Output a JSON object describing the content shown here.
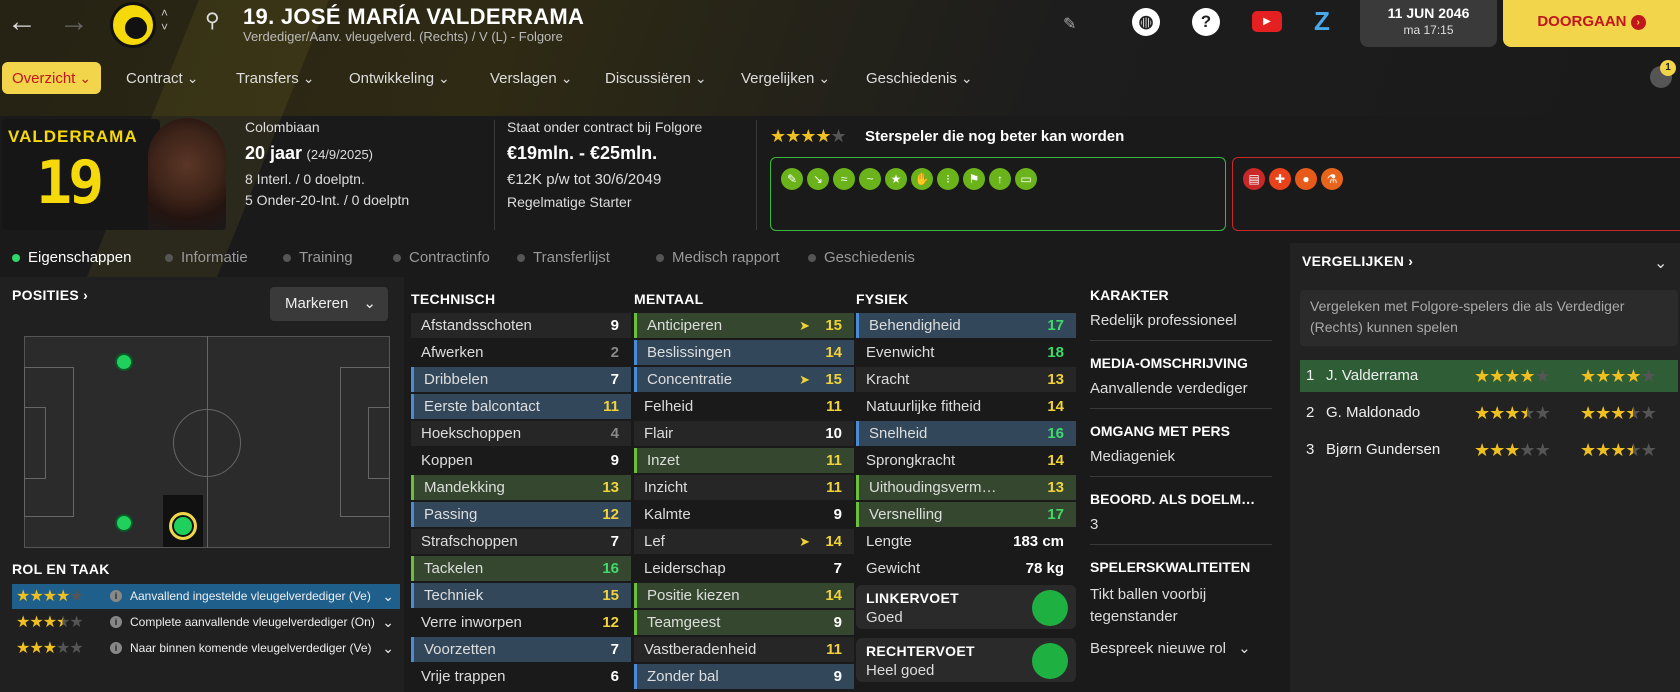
{
  "header": {
    "player_name": "19. JOSÉ MARÍA VALDERRAMA",
    "subtitle": "Verdediger/Aanv. vleugelverd. (Rechts) / V (L) - Folgore",
    "date": "11 JUN 2046",
    "time": "ma 17:15",
    "continue_label": "DOORGAAN",
    "notification_count": "1"
  },
  "menu": [
    {
      "label": "Overzicht",
      "active": true
    },
    {
      "label": "Contract"
    },
    {
      "label": "Transfers"
    },
    {
      "label": "Ontwikkeling"
    },
    {
      "label": "Verslagen"
    },
    {
      "label": "Discussiëren"
    },
    {
      "label": "Vergelijken"
    },
    {
      "label": "Geschiedenis"
    }
  ],
  "card": {
    "shirt_name": "VALDERRAMA",
    "shirt_number": "19",
    "nationality": "Colombiaan",
    "age": "20 jaar",
    "dob": "(24/9/2025)",
    "caps": "8 Interl. / 0 doelptn.",
    "youth_caps": "5 Onder-20-Int. / 0 doelptn",
    "contract_line": "Staat onder contract bij Folgore",
    "value": "€19mln. - €25mln.",
    "wage": "€12K p/w tot 30/6/2049",
    "status": "Regelmatige Starter",
    "rating_text": "Sterspeler die nog beter kan worden",
    "rating_stars": 4
  },
  "subtabs": [
    "Eigenschappen",
    "Informatie",
    "Training",
    "Contractinfo",
    "Transferlijst",
    "Medisch rapport",
    "Geschiedenis"
  ],
  "positions": {
    "title": "POSITIES",
    "mark_label": "Markeren"
  },
  "roles": {
    "title": "ROL EN TAAK",
    "items": [
      {
        "name": "Aanvallend ingestelde vleugelverdediger (Ve)",
        "stars": 4
      },
      {
        "name": "Complete aanvallende vleugelverdediger (On)",
        "stars": 3.5
      },
      {
        "name": "Naar binnen komende vleugelverdediger (Ve)",
        "stars": 3
      }
    ]
  },
  "technical": {
    "title": "TECHNISCH",
    "rows": [
      {
        "name": "Afstandsschoten",
        "value": "9",
        "hl": "",
        "vc": "white"
      },
      {
        "name": "Afwerken",
        "value": "2",
        "hl": "",
        "vc": "grey"
      },
      {
        "name": "Dribbelen",
        "value": "7",
        "hl": "blue",
        "vc": "white"
      },
      {
        "name": "Eerste balcontact",
        "value": "11",
        "hl": "blue",
        "vc": "yellow"
      },
      {
        "name": "Hoekschoppen",
        "value": "4",
        "hl": "",
        "vc": "grey"
      },
      {
        "name": "Koppen",
        "value": "9",
        "hl": "",
        "vc": "white"
      },
      {
        "name": "Mandekking",
        "value": "13",
        "hl": "green",
        "vc": "yellow"
      },
      {
        "name": "Passing",
        "value": "12",
        "hl": "blue",
        "vc": "yellow"
      },
      {
        "name": "Strafschoppen",
        "value": "7",
        "hl": "",
        "vc": "white"
      },
      {
        "name": "Tackelen",
        "value": "16",
        "hl": "green",
        "vc": "green"
      },
      {
        "name": "Techniek",
        "value": "15",
        "hl": "blue",
        "vc": "yellow"
      },
      {
        "name": "Verre inworpen",
        "value": "12",
        "hl": "",
        "vc": "yellow"
      },
      {
        "name": "Voorzetten",
        "value": "7",
        "hl": "blue",
        "vc": "white"
      },
      {
        "name": "Vrije trappen",
        "value": "6",
        "hl": "",
        "vc": "white"
      }
    ]
  },
  "mental": {
    "title": "MENTAAL",
    "rows": [
      {
        "name": "Anticiperen",
        "value": "15",
        "hl": "green",
        "vc": "yellow",
        "arrow": true
      },
      {
        "name": "Beslissingen",
        "value": "14",
        "hl": "blue",
        "vc": "yellow"
      },
      {
        "name": "Concentratie",
        "value": "15",
        "hl": "blue",
        "vc": "yellow",
        "arrow": true
      },
      {
        "name": "Felheid",
        "value": "11",
        "hl": "",
        "vc": "yellow"
      },
      {
        "name": "Flair",
        "value": "10",
        "hl": "",
        "vc": "white"
      },
      {
        "name": "Inzet",
        "value": "11",
        "hl": "green",
        "vc": "yellow"
      },
      {
        "name": "Inzicht",
        "value": "11",
        "hl": "",
        "vc": "yellow"
      },
      {
        "name": "Kalmte",
        "value": "9",
        "hl": "",
        "vc": "white"
      },
      {
        "name": "Lef",
        "value": "14",
        "hl": "",
        "vc": "yellow",
        "arrow": true
      },
      {
        "name": "Leiderschap",
        "value": "7",
        "hl": "",
        "vc": "white"
      },
      {
        "name": "Positie kiezen",
        "value": "14",
        "hl": "green",
        "vc": "yellow"
      },
      {
        "name": "Teamgeest",
        "value": "9",
        "hl": "green",
        "vc": "white"
      },
      {
        "name": "Vastberadenheid",
        "value": "11",
        "hl": "",
        "vc": "yellow"
      },
      {
        "name": "Zonder bal",
        "value": "9",
        "hl": "blue",
        "vc": "white"
      }
    ]
  },
  "physical": {
    "title": "FYSIEK",
    "rows": [
      {
        "name": "Behendigheid",
        "value": "17",
        "hl": "blue",
        "vc": "green"
      },
      {
        "name": "Evenwicht",
        "value": "18",
        "hl": "",
        "vc": "green"
      },
      {
        "name": "Kracht",
        "value": "13",
        "hl": "",
        "vc": "yellow"
      },
      {
        "name": "Natuurlijke fitheid",
        "value": "14",
        "hl": "",
        "vc": "yellow"
      },
      {
        "name": "Snelheid",
        "value": "16",
        "hl": "blue",
        "vc": "green"
      },
      {
        "name": "Sprongkracht",
        "value": "14",
        "hl": "",
        "vc": "yellow"
      },
      {
        "name": "Uithoudingsverm…",
        "value": "13",
        "hl": "green",
        "vc": "yellow"
      },
      {
        "name": "Versnelling",
        "value": "17",
        "hl": "green",
        "vc": "green"
      }
    ],
    "height_label": "Lengte",
    "height": "183 cm",
    "weight_label": "Gewicht",
    "weight": "78 kg",
    "left_foot_label": "LINKERVOET",
    "left_foot": "Goed",
    "right_foot_label": "RECHTERVOET",
    "right_foot": "Heel goed"
  },
  "info": {
    "character_label": "KARAKTER",
    "character": "Redelijk professioneel",
    "media_label": "MEDIA-OMSCHRIJVING",
    "media": "Aanvallende verdediger",
    "press_label": "OMGANG MET PERS",
    "press": "Mediageniek",
    "gk_label": "BEOORD. ALS DOELM…",
    "gk": "3",
    "traits_label": "SPELERSKWALITEITEN",
    "traits": "Tikt ballen voorbij tegenstander",
    "discuss_label": "Bespreek nieuwe rol"
  },
  "compare": {
    "title": "VERGELIJKEN",
    "desc": "Vergeleken met Folgore-spelers die als Verdediger (Rechts) kunnen spelen",
    "rows": [
      {
        "rank": "1",
        "name": "J. Valderrama",
        "cur": 4,
        "pot": 4
      },
      {
        "rank": "2",
        "name": "G. Maldonado",
        "cur": 3.5,
        "pot": 3.5
      },
      {
        "rank": "3",
        "name": "Bjørn Gundersen",
        "cur": 3,
        "pot": 3.5
      }
    ]
  },
  "colors": {
    "accent": "#f2d54a",
    "danger": "#c0161c",
    "good": "#3edb6b",
    "warn": "#f0d23a"
  }
}
